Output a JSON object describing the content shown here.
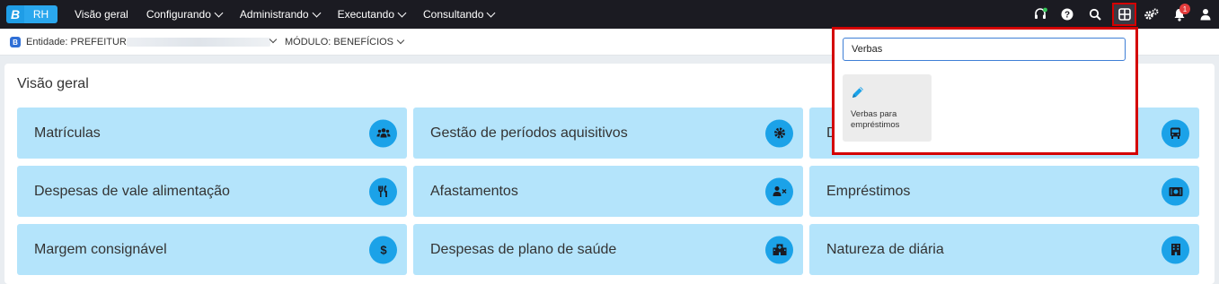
{
  "brand": {
    "mark": "B",
    "product": "RH"
  },
  "nav": [
    {
      "label": "Visão geral",
      "has_menu": false
    },
    {
      "label": "Configurando",
      "has_menu": true
    },
    {
      "label": "Administrando",
      "has_menu": true
    },
    {
      "label": "Executando",
      "has_menu": true
    },
    {
      "label": "Consultando",
      "has_menu": true
    }
  ],
  "toolbar": {
    "icons": [
      "headset-icon",
      "help-icon",
      "search-icon",
      "apps-grid-icon",
      "settings-icon",
      "bell-icon",
      "user-icon"
    ],
    "notification_count": "1"
  },
  "context": {
    "entity_badge": "B",
    "entity_label": "Entidade: PREFEITURA",
    "module_label": "MÓDULO: BENEFÍCIOS"
  },
  "page": {
    "title": "Visão geral"
  },
  "cards": [
    {
      "label": "Matrículas",
      "icon": "users-icon"
    },
    {
      "label": "Gestão de períodos aquisitivos",
      "icon": "gear-icon"
    },
    {
      "label": "D",
      "icon": "bus-icon"
    },
    {
      "label": "Despesas de vale alimentação",
      "icon": "fork-knife-icon"
    },
    {
      "label": "Afastamentos",
      "icon": "user-remove-icon"
    },
    {
      "label": "Empréstimos",
      "icon": "money-icon"
    },
    {
      "label": "Margem consignável",
      "icon": "dollar-icon"
    },
    {
      "label": "Despesas de plano de saúde",
      "icon": "hospital-icon"
    },
    {
      "label": "Natureza de diária",
      "icon": "building-icon"
    }
  ],
  "apps_dropdown": {
    "search_value": "Verbas",
    "results": [
      {
        "label": "Verbas para empréstimos",
        "icon": "pencil-icon"
      }
    ]
  },
  "colors": {
    "topbar": "#1b1b22",
    "card_bg": "#b4e4fb",
    "card_icon": "#1ba2e8",
    "highlight": "#d40000"
  }
}
